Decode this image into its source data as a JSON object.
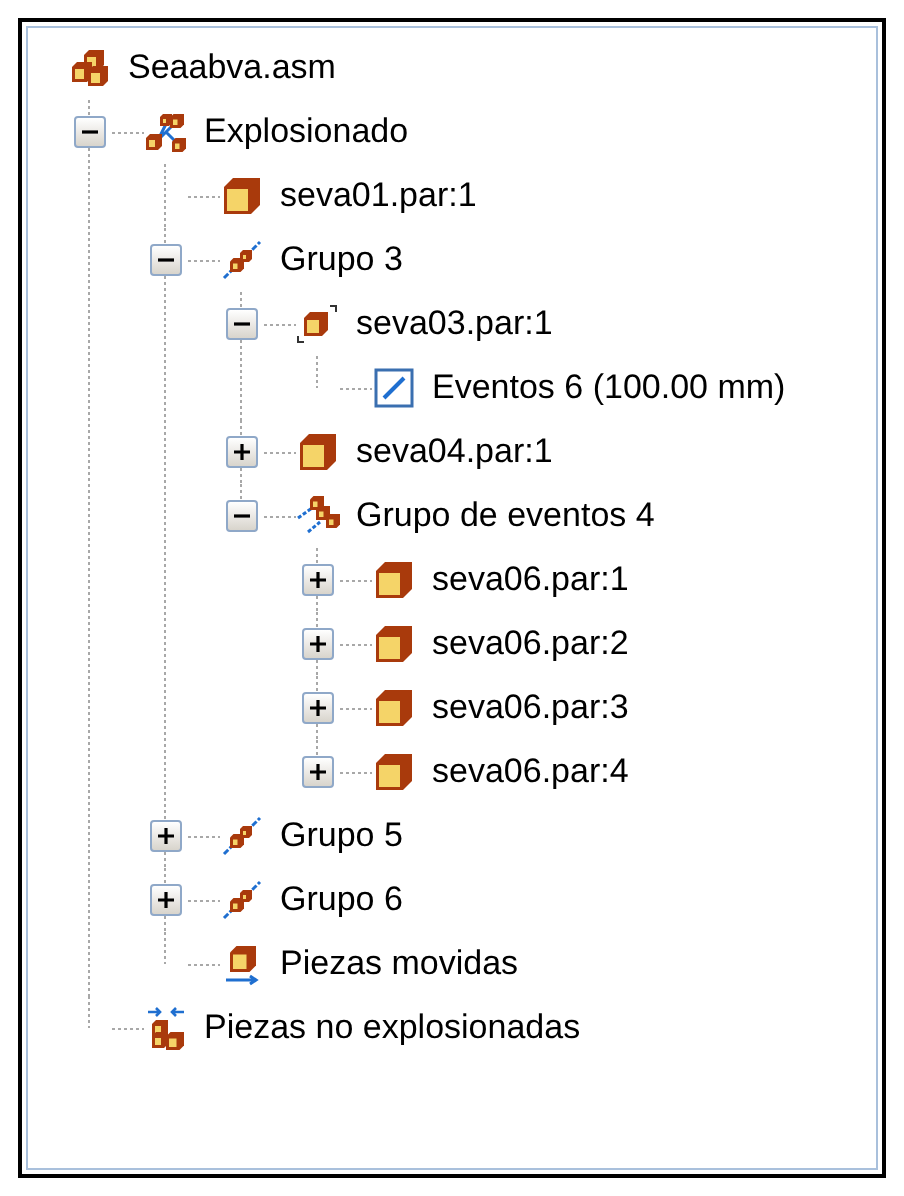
{
  "tree": {
    "label": "Seaabva.asm",
    "kind": "assembly",
    "children": [
      {
        "label": "Explosionado",
        "kind": "explode",
        "expanded": true,
        "children": [
          {
            "label": "seva01.par:1",
            "kind": "part"
          },
          {
            "label": "Grupo 3",
            "kind": "group",
            "expanded": true,
            "children": [
              {
                "label": "seva03.par:1",
                "kind": "event-part",
                "expanded": true,
                "children": [
                  {
                    "label": "Eventos 6 (100.00 mm)",
                    "kind": "event"
                  }
                ]
              },
              {
                "label": "seva04.par:1",
                "kind": "part",
                "expanded": false
              },
              {
                "label": "Grupo de eventos 4",
                "kind": "event-group",
                "expanded": true,
                "children": [
                  {
                    "label": "seva06.par:1",
                    "kind": "part",
                    "expanded": false
                  },
                  {
                    "label": "seva06.par:2",
                    "kind": "part",
                    "expanded": false
                  },
                  {
                    "label": "seva06.par:3",
                    "kind": "part",
                    "expanded": false
                  },
                  {
                    "label": "seva06.par:4",
                    "kind": "part",
                    "expanded": false
                  }
                ]
              }
            ]
          },
          {
            "label": "Grupo 5",
            "kind": "group",
            "expanded": false
          },
          {
            "label": "Grupo 6",
            "kind": "group",
            "expanded": false
          },
          {
            "label": "Piezas movidas",
            "kind": "moved"
          }
        ]
      },
      {
        "label": "Piezas no explosionadas",
        "kind": "unexploded"
      }
    ]
  }
}
